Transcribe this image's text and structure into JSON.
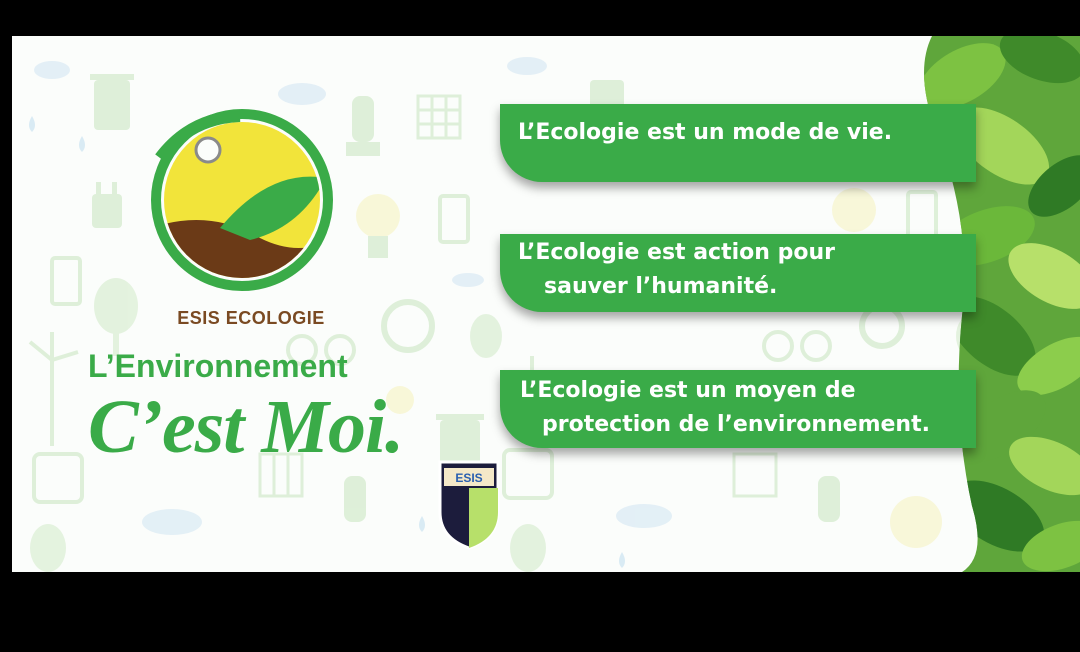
{
  "brand": {
    "name": "ESIS ECOLOGIE"
  },
  "tagline": {
    "line1": "L’Environnement",
    "line2": "C’est Moi."
  },
  "statements": [
    {
      "line1": "L’Ecologie est un mode de vie.",
      "line2": ""
    },
    {
      "line1": "L’Ecologie est action pour",
      "line2": "sauver l’humanité."
    },
    {
      "line1": "L’Ecologie est un moyen de",
      "line2": "protection de l’environnement."
    }
  ],
  "badge": {
    "label": "ESIS"
  },
  "colors": {
    "primary_green": "#3aab48",
    "earth_brown": "#6b3a17",
    "sun_yellow": "#f2e43a",
    "background": "#fbfdfb",
    "frame": "#000000"
  },
  "icons": [
    "trash-icon",
    "water-drop-icon",
    "cloud-icon",
    "solar-panel-icon",
    "energy-saving-bulb-icon",
    "light-bulb-icon",
    "battery-icon",
    "plug-icon",
    "tree-icon",
    "recycle-icon",
    "bicycle-icon",
    "wind-turbine-icon",
    "power-socket-icon",
    "sun-icon",
    "leaf-icon"
  ]
}
